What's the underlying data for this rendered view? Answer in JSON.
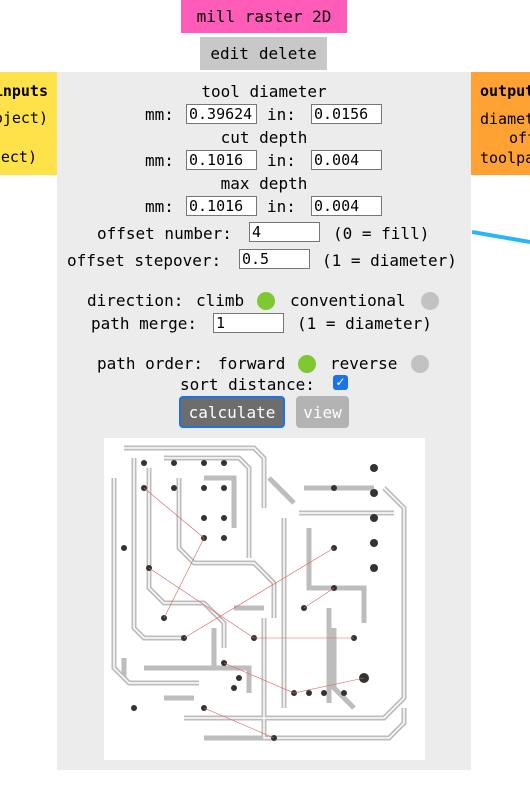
{
  "module": {
    "title": "mill raster 2D",
    "edit_label": "edit",
    "delete_label": "delete"
  },
  "inputs_box": {
    "title": "inputs",
    "line1": "(object)",
    "line2": "(object)"
  },
  "outputs_box": {
    "title": "outputs",
    "line1": "diameter",
    "line2": "offset",
    "line3": "toolpath"
  },
  "form": {
    "tool_diameter": {
      "heading": "tool diameter",
      "mm_label": "mm:",
      "mm_value": "0.39624",
      "in_label": "in:",
      "in_value": "0.0156"
    },
    "cut_depth": {
      "heading": "cut depth",
      "mm_label": "mm:",
      "mm_value": "0.1016",
      "in_label": "in:",
      "in_value": "0.004"
    },
    "max_depth": {
      "heading": "max depth",
      "mm_label": "mm:",
      "mm_value": "0.1016",
      "in_label": "in:",
      "in_value": "0.004"
    },
    "offset_number": {
      "label": "offset number:",
      "value": "4",
      "hint": "(0 = fill)"
    },
    "offset_stepover": {
      "label": "offset stepover:",
      "value": "0.5",
      "hint": "(1 = diameter)"
    },
    "direction": {
      "label": "direction:",
      "option1": "climb",
      "option2": "conventional",
      "selected": "climb"
    },
    "path_merge": {
      "label": "path merge:",
      "value": "1",
      "hint": "(1 = diameter)"
    },
    "path_order": {
      "label": "path order:",
      "option1": "forward",
      "option2": "reverse",
      "selected": "forward"
    },
    "sort_distance": {
      "label": "sort distance:",
      "checked": true
    },
    "calculate_label": "calculate",
    "view_label": "view"
  },
  "colors": {
    "title_bg": "#ff5bb8",
    "inputs_bg": "#ffe14a",
    "outputs_bg": "#ffa233",
    "panel_bg": "#ececec",
    "radio_on": "#7fc832",
    "radio_off": "#c2c2c2",
    "wire": "#29b6f6"
  }
}
